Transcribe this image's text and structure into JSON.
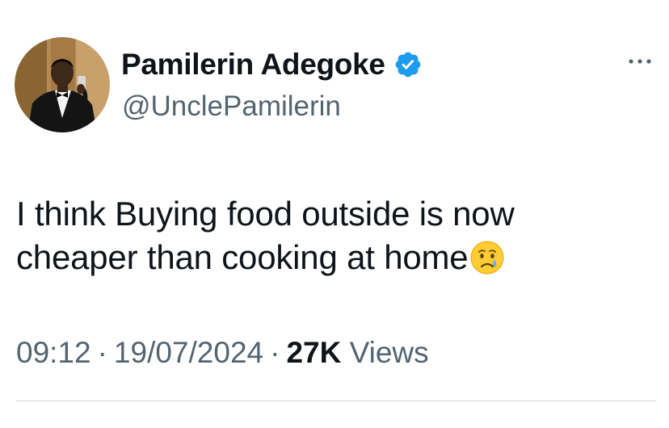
{
  "author": {
    "display_name": "Pamilerin Adegoke",
    "handle": "@UnclePamilerin",
    "verified": true,
    "avatar_icon": "profile-photo-man-in-tuxedo"
  },
  "tweet": {
    "text_line1": "I think Buying food outside is now",
    "text_line2": "cheaper than cooking at home",
    "emoji": "crying-face-emoji"
  },
  "meta": {
    "time": "09:12",
    "separator": "·",
    "date": "19/07/2024",
    "views_count": "27K",
    "views_label": "Views"
  },
  "icons": {
    "more": "more-options-icon",
    "verified": "verified-badge-icon"
  },
  "colors": {
    "primary_text": "#0f1419",
    "secondary_text": "#536471",
    "verified_blue": "#1d9bf0",
    "divider": "#cfd9de"
  }
}
